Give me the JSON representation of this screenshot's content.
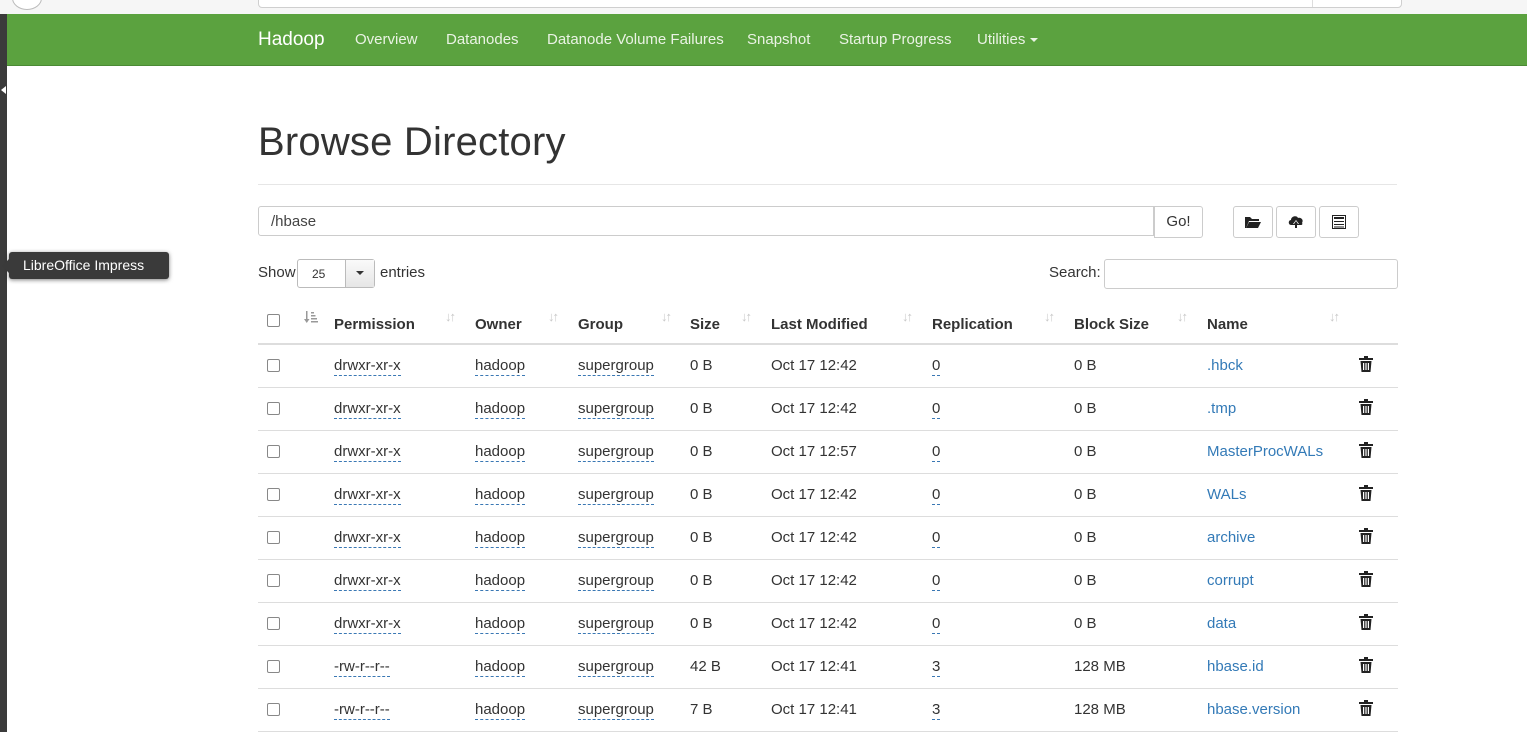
{
  "navbar": {
    "brand": "Hadoop",
    "items": [
      "Overview",
      "Datanodes",
      "Datanode Volume Failures",
      "Snapshot",
      "Startup Progress",
      "Utilities"
    ]
  },
  "page": {
    "title": "Browse Directory"
  },
  "path": {
    "value": "/hbase",
    "go_label": "Go!"
  },
  "toolbar_icons": [
    "folder-open-icon",
    "cloud-upload-icon",
    "list-icon"
  ],
  "controls": {
    "show_label": "Show",
    "entries_value": "25",
    "entries_label": "entries",
    "search_label": "Search:"
  },
  "table": {
    "columns": [
      "Permission",
      "Owner",
      "Group",
      "Size",
      "Last Modified",
      "Replication",
      "Block Size",
      "Name"
    ],
    "rows": [
      {
        "permission": "drwxr-xr-x",
        "owner": "hadoop",
        "group": "supergroup",
        "size": "0 B",
        "modified": "Oct 17 12:42",
        "replication": "0",
        "block_size": "0 B",
        "name": ".hbck"
      },
      {
        "permission": "drwxr-xr-x",
        "owner": "hadoop",
        "group": "supergroup",
        "size": "0 B",
        "modified": "Oct 17 12:42",
        "replication": "0",
        "block_size": "0 B",
        "name": ".tmp"
      },
      {
        "permission": "drwxr-xr-x",
        "owner": "hadoop",
        "group": "supergroup",
        "size": "0 B",
        "modified": "Oct 17 12:57",
        "replication": "0",
        "block_size": "0 B",
        "name": "MasterProcWALs"
      },
      {
        "permission": "drwxr-xr-x",
        "owner": "hadoop",
        "group": "supergroup",
        "size": "0 B",
        "modified": "Oct 17 12:42",
        "replication": "0",
        "block_size": "0 B",
        "name": "WALs"
      },
      {
        "permission": "drwxr-xr-x",
        "owner": "hadoop",
        "group": "supergroup",
        "size": "0 B",
        "modified": "Oct 17 12:42",
        "replication": "0",
        "block_size": "0 B",
        "name": "archive"
      },
      {
        "permission": "drwxr-xr-x",
        "owner": "hadoop",
        "group": "supergroup",
        "size": "0 B",
        "modified": "Oct 17 12:42",
        "replication": "0",
        "block_size": "0 B",
        "name": "corrupt"
      },
      {
        "permission": "drwxr-xr-x",
        "owner": "hadoop",
        "group": "supergroup",
        "size": "0 B",
        "modified": "Oct 17 12:42",
        "replication": "0",
        "block_size": "0 B",
        "name": "data"
      },
      {
        "permission": "-rw-r--r--",
        "owner": "hadoop",
        "group": "supergroup",
        "size": "42 B",
        "modified": "Oct 17 12:41",
        "replication": "3",
        "block_size": "128 MB",
        "name": "hbase.id"
      },
      {
        "permission": "-rw-r--r--",
        "owner": "hadoop",
        "group": "supergroup",
        "size": "7 B",
        "modified": "Oct 17 12:41",
        "replication": "3",
        "block_size": "128 MB",
        "name": "hbase.version"
      }
    ]
  },
  "tooltip": {
    "text": "LibreOffice Impress"
  },
  "colors": {
    "navbar": "#5ba23f",
    "link": "#337ab7"
  }
}
